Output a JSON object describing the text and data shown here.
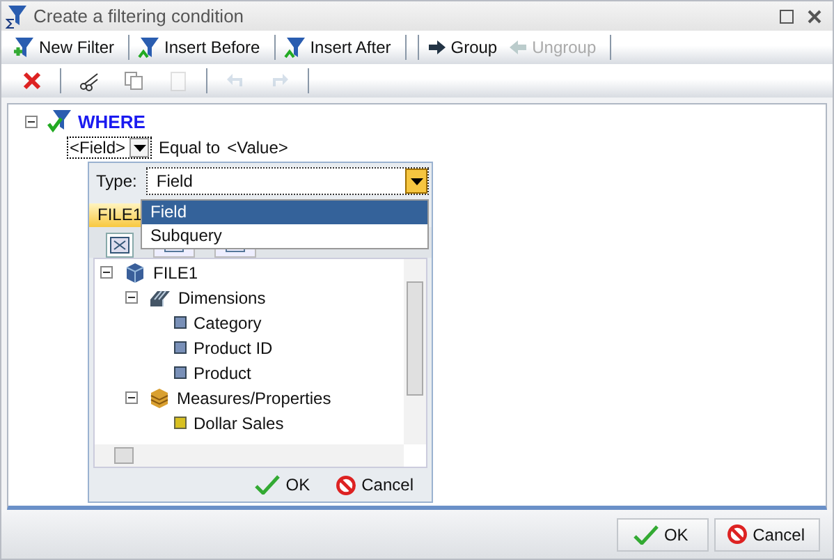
{
  "window": {
    "title": "Create a filtering condition"
  },
  "toolbar": [
    {
      "label": "New Filter",
      "kind": "new",
      "disabled": false
    },
    {
      "label": "Insert Before",
      "kind": "before",
      "disabled": false
    },
    {
      "label": "Insert After",
      "kind": "after",
      "disabled": false
    },
    {
      "label": "Group",
      "kind": "group",
      "disabled": false
    },
    {
      "label": "Ungroup",
      "kind": "ungroup",
      "disabled": true
    }
  ],
  "edit_toolbar": [
    {
      "kind": "delete",
      "disabled": false
    },
    {
      "kind": "cut",
      "disabled": false
    },
    {
      "kind": "copy",
      "disabled": false
    },
    {
      "kind": "paste",
      "disabled": true
    },
    {
      "kind": "undo",
      "disabled": true
    },
    {
      "kind": "redo",
      "disabled": true
    }
  ],
  "filter": {
    "root": "WHERE",
    "expanded": true,
    "field": "<Field>",
    "operator": "Equal to",
    "value": "<Value>"
  },
  "picker": {
    "type_label": "Type:",
    "type_value": "Field",
    "options": [
      {
        "label": "Field",
        "selected": true
      },
      {
        "label": "Subquery",
        "selected": false
      }
    ],
    "source_tab": {
      "label": "FILE1",
      "selected": true
    },
    "view_tabs": [
      {
        "kind": "diagram",
        "selected": true
      },
      {
        "kind": "list",
        "selected": false
      },
      {
        "kind": "table",
        "selected": false
      }
    ],
    "tree": [
      {
        "label": "FILE1",
        "kind": "file",
        "expanded": true,
        "children": [
          {
            "label": "Dimensions",
            "kind": "dimensions",
            "expanded": true,
            "children": [
              {
                "label": "Category",
                "kind": "dimension"
              },
              {
                "label": "Product ID",
                "kind": "dimension"
              },
              {
                "label": "Product",
                "kind": "dimension"
              }
            ]
          },
          {
            "label": "Measures/Properties",
            "kind": "measures",
            "expanded": true,
            "children": [
              {
                "label": "Dollar Sales",
                "kind": "measure"
              }
            ]
          }
        ]
      }
    ],
    "buttons": [
      {
        "label": "OK",
        "kind": "ok"
      },
      {
        "label": "Cancel",
        "kind": "cancel"
      }
    ]
  },
  "buttons": [
    {
      "label": "OK",
      "kind": "ok"
    },
    {
      "label": "Cancel",
      "kind": "cancel"
    }
  ]
}
